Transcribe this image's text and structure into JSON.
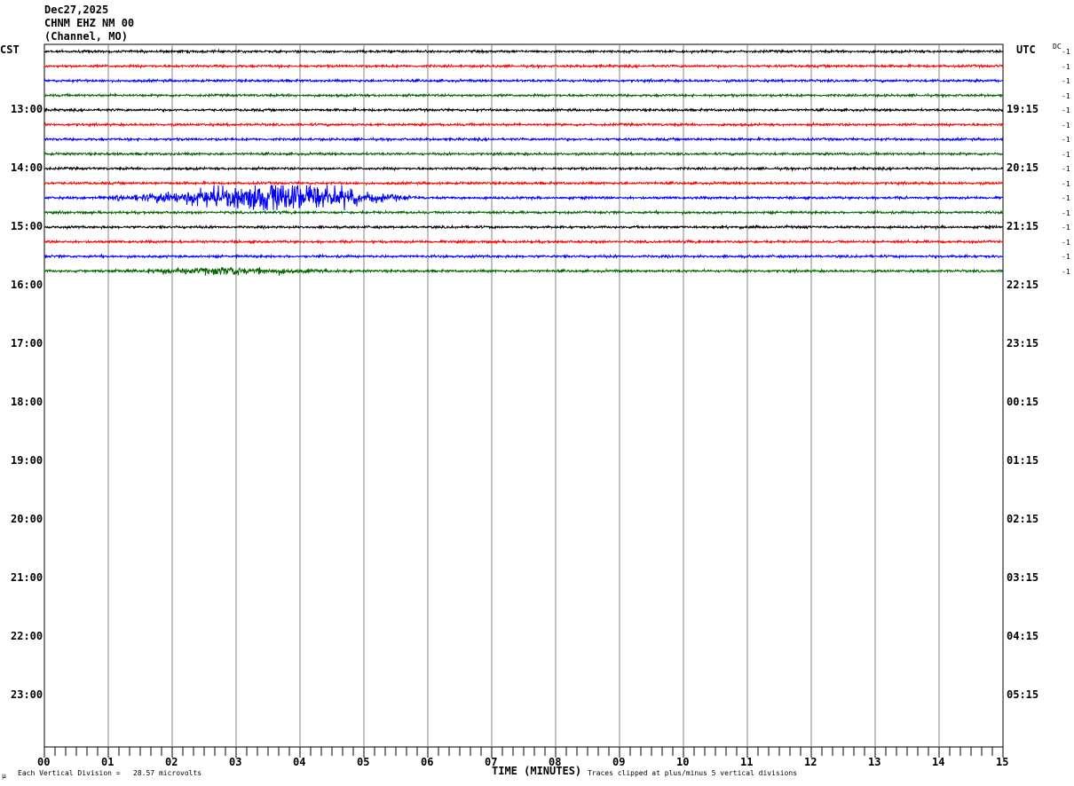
{
  "header": {
    "date": "Dec27,2025",
    "station": "CHNM EHZ NM 00",
    "subtitle": "(Channel, MO)"
  },
  "left_tz": "CST",
  "right_tz": "UTC",
  "dc_label": "DC",
  "footer": {
    "mu_symbol": "µ",
    "scale": "Each Vertical Division =   28.57 microvolts",
    "xlabel": "TIME (MINUTES)",
    "clip": "Traces clipped at plus/minus 5 vertical divisions"
  },
  "chart_data": {
    "type": "line",
    "title": "CHNM EHZ NM 00 Dec27,2025",
    "xlabel": "TIME (MINUTES)",
    "xlim": [
      0,
      15
    ],
    "x_ticks": [
      "00",
      "01",
      "02",
      "03",
      "04",
      "05",
      "06",
      "07",
      "08",
      "09",
      "10",
      "11",
      "12",
      "13",
      "14",
      "15"
    ],
    "left_hour_labels": [
      "13:00",
      "14:00",
      "15:00",
      "16:00",
      "17:00",
      "18:00",
      "19:00",
      "20:00",
      "21:00",
      "22:00",
      "23:00"
    ],
    "right_hour_labels": [
      "19:15",
      "20:15",
      "21:15",
      "22:15",
      "23:15",
      "00:15",
      "01:15",
      "02:15",
      "03:15",
      "04:15",
      "05:15"
    ],
    "trace_colors": [
      "#000000",
      "#ff0000",
      "#0000ff",
      "#006400"
    ],
    "traces": [
      {
        "dc": "-1"
      },
      {
        "dc": "-1"
      },
      {
        "dc": "-1"
      },
      {
        "dc": "-1"
      },
      {
        "dc": "-1"
      },
      {
        "dc": "-1"
      },
      {
        "dc": "-1"
      },
      {
        "dc": "-1"
      },
      {
        "dc": "-1"
      },
      {
        "dc": "-1"
      },
      {
        "dc": "-1",
        "event": {
          "start_min": 0.5,
          "peak_min": 3.9,
          "end_min": 6.0,
          "peak_divisions": 2.5
        }
      },
      {
        "dc": "-1"
      },
      {
        "dc": "-1"
      },
      {
        "dc": "-1"
      },
      {
        "dc": "-1"
      },
      {
        "dc": "-1",
        "event": {
          "start_min": 0.5,
          "peak_min": 2.9,
          "end_min": 5.0,
          "peak_divisions": 0.5
        }
      }
    ]
  }
}
